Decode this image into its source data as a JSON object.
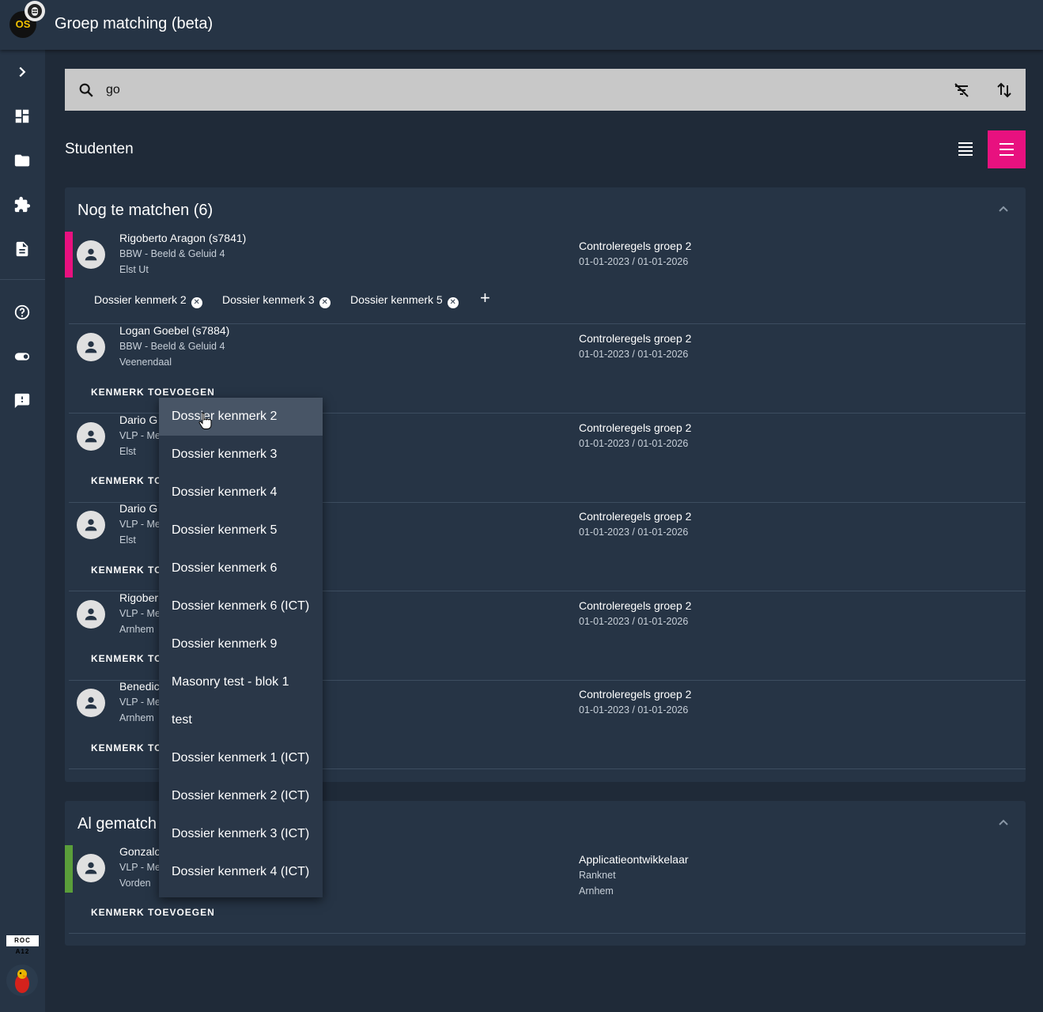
{
  "app": {
    "logo_text": "OS",
    "title": "Groep matching (beta)"
  },
  "sidebar": {
    "icons": [
      "chevron-right-icon",
      "dashboard-icon",
      "folder-icon",
      "puzzle-icon",
      "document-icon",
      "help-icon",
      "toggle-icon",
      "feedback-icon"
    ],
    "org_logo_text": "ROC A12"
  },
  "search": {
    "value": "go"
  },
  "section": {
    "title": "Studenten"
  },
  "colors": {
    "accent": "#e8117f",
    "pending_bar": "#e8117f",
    "matched_bar": "#5a9e3a"
  },
  "panels": {
    "pending": {
      "title": "Nog te matchen (6)",
      "rows": [
        {
          "name": "Rigoberto Aragon (s7841)",
          "program": "BBW - Beeld & Geluid 4",
          "location": "Elst Ut",
          "group": "Controleregels groep 2",
          "dates": "01-01-2023 / 01-01-2026",
          "chips": [
            "Dossier kenmerk 2",
            "Dossier kenmerk 3",
            "Dossier kenmerk 5"
          ],
          "chip_add": "+"
        },
        {
          "name": "Logan Goebel (s7884)",
          "program": "BBW - Beeld & Geluid 4",
          "location": "Veenendaal",
          "group": "Controleregels groep 2",
          "dates": "01-01-2023 / 01-01-2026",
          "action": "KENMERK TOEVOEGEN"
        },
        {
          "name": "Dario G",
          "program": "VLP - Me",
          "location": "Elst",
          "group": "Controleregels groep 2",
          "dates": "01-01-2023 / 01-01-2026",
          "action": "KENMERK TOE"
        },
        {
          "name": "Dario G",
          "program": "VLP - Me",
          "location": "Elst",
          "group": "Controleregels groep 2",
          "dates": "01-01-2023 / 01-01-2026",
          "action": "KENMERK TOE"
        },
        {
          "name": "Rigober",
          "program": "VLP - Me",
          "location": "Arnhem",
          "group": "Controleregels groep 2",
          "dates": "01-01-2023 / 01-01-2026",
          "action": "KENMERK TOE"
        },
        {
          "name": "Benedic",
          "program": "VLP - Me",
          "location": "Arnhem",
          "group": "Controleregels groep 2",
          "dates": "01-01-2023 / 01-01-2026",
          "action": "KENMERK TOE"
        }
      ]
    },
    "matched": {
      "title": "Al gematch",
      "rows": [
        {
          "name": "Gonzalo",
          "program": "VLP - Me",
          "location": "Vorden",
          "group": "Applicatieontwikkelaar",
          "company": "Ranknet",
          "city": "Arnhem",
          "action": "KENMERK TOEVOEGEN"
        }
      ]
    }
  },
  "dropdown": {
    "items": [
      "Dossier kenmerk 2",
      "Dossier kenmerk 3",
      "Dossier kenmerk 4",
      "Dossier kenmerk 5",
      "Dossier kenmerk 6",
      "Dossier kenmerk 6 (ICT)",
      "Dossier kenmerk 9",
      "Masonry test - blok 1",
      "test",
      "Dossier kenmerk 1 (ICT)",
      "Dossier kenmerk 2 (ICT)",
      "Dossier kenmerk 3 (ICT)",
      "Dossier kenmerk 4 (ICT)"
    ],
    "hovered_index": 0
  }
}
